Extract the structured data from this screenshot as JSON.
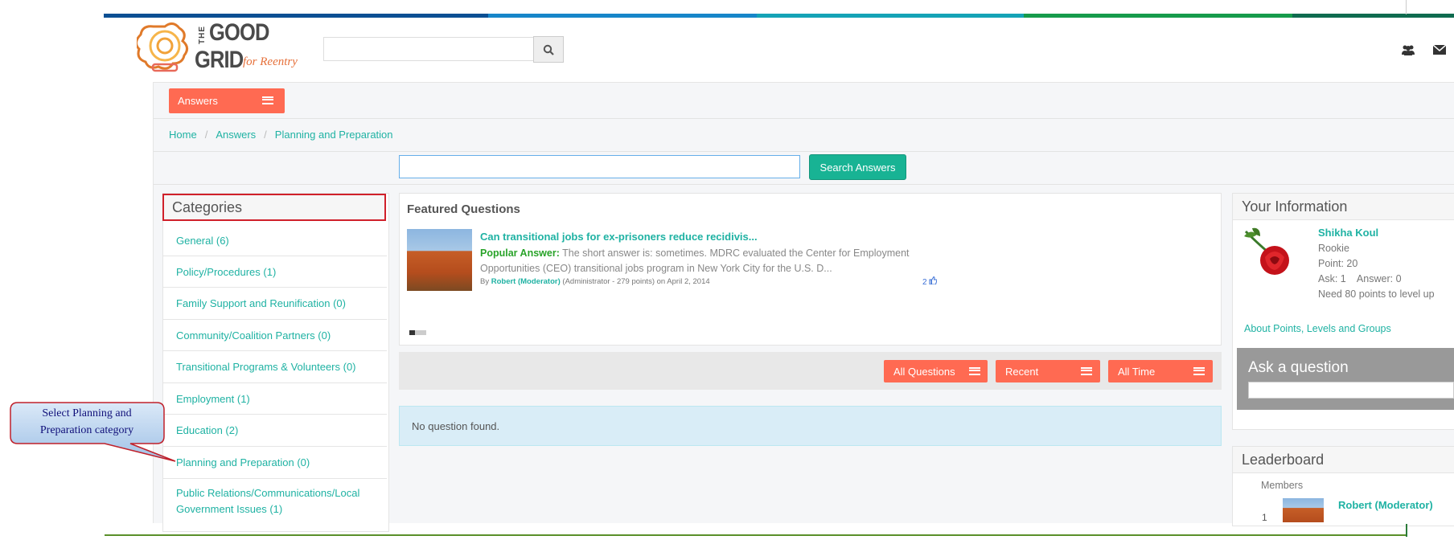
{
  "colors": {
    "topbar": [
      "#0c4f93",
      "#1786c9",
      "#15a3b6",
      "#169b4b",
      "#0f6b4f"
    ],
    "accent": "#ff6a52",
    "link": "#1fb2a3",
    "search_button": "#18b394",
    "highlight_border": "#d0202a"
  },
  "header": {
    "logo_text_the": "THE",
    "logo_text_good": "GOOD",
    "logo_text_grid": "GRID",
    "logo_text_tagline": "for Reentry",
    "search_placeholder": "",
    "icons": [
      "search-icon",
      "group-icon",
      "mail-icon"
    ]
  },
  "nav": {
    "answers_label": "Answers"
  },
  "breadcrumb": [
    "Home",
    "Answers",
    "Planning and Preparation"
  ],
  "answers_search": {
    "placeholder": "",
    "button_label": "Search Answers"
  },
  "categories": {
    "title": "Categories",
    "items": [
      "General (6)",
      "Policy/Procedures (1)",
      "Family Support and Reunification (0)",
      "Community/Coalition Partners (0)",
      "Transitional Programs & Volunteers (0)",
      "Employment (1)",
      "Education (2)",
      "Planning and Preparation (0)",
      "Public Relations/Communications/Local Government Issues (1)"
    ]
  },
  "featured": {
    "title": "Featured Questions",
    "question": "Can transitional jobs for ex-prisoners reduce recidivis...",
    "popular_label": "Popular Answer:",
    "popular_text": "The short answer is: sometimes. MDRC evaluated the Center for Employment Opportunities (CEO) transitional jobs program in New York City for the U.S. D...",
    "by_prefix": "By",
    "author": "Robert (Moderator)",
    "author_meta": "(Administrator - 279 points)",
    "date": "on April 2, 2014",
    "votes": "2"
  },
  "filters": {
    "all_questions": "All Questions",
    "recent": "Recent",
    "all_time": "All Time"
  },
  "no_question": "No question found.",
  "your_info": {
    "title": "Your Information",
    "name": "Shikha Koul",
    "rank": "Rookie",
    "points": "Point: 20",
    "ask_answer": "Ask: 1    Answer: 0",
    "need": "Need 80 points to level up",
    "about_link": "About Points, Levels and Groups"
  },
  "ask": {
    "title": "Ask a question",
    "placeholder": ""
  },
  "leaderboard": {
    "title": "Leaderboard",
    "members_label": "Members",
    "rows": [
      {
        "rank": "1",
        "name": "Robert (Moderator)"
      }
    ]
  },
  "callout": {
    "line1": "Select Planning and",
    "line2": "Preparation category"
  }
}
